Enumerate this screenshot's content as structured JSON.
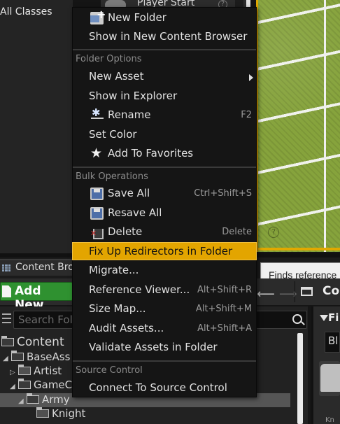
{
  "background": {
    "class_picker_label": "All Classes",
    "outliner_item": "Player Start",
    "outliner_help": "?",
    "viewport_help": "?"
  },
  "content_browser": {
    "tab_label": "Content Bro",
    "add_new_label": "Add New",
    "breadcrumb_text": "Co",
    "search_placeholder": "Search Fold",
    "filters_label": "Fi",
    "filter_chip": "Bl",
    "asset_name": "Kn",
    "tree": [
      {
        "label": "Content",
        "expander": "",
        "open": true
      },
      {
        "label": "BaseAss",
        "expander": "◢",
        "open": true
      },
      {
        "label": "Artist",
        "expander": "▷",
        "open": false
      },
      {
        "label": "GameC",
        "expander": "◢",
        "open": true
      },
      {
        "label": "Army",
        "expander": "◢",
        "open": true
      },
      {
        "label": "Knight",
        "expander": "",
        "open": false
      }
    ]
  },
  "tooltip": "Finds reference",
  "menu": {
    "new_folder": "New Folder",
    "show_in_new_cb": "Show in New Content Browser",
    "section_folder_options": "Folder Options",
    "new_asset": "New Asset",
    "show_in_explorer": "Show in Explorer",
    "rename": "Rename",
    "rename_shortcut": "F2",
    "set_color": "Set Color",
    "add_to_favorites": "Add To Favorites",
    "section_bulk": "Bulk Operations",
    "save_all": "Save All",
    "save_all_shortcut": "Ctrl+Shift+S",
    "resave_all": "Resave All",
    "delete": "Delete",
    "delete_shortcut": "Delete",
    "fix_up_redirectors": "Fix Up Redirectors in Folder",
    "migrate": "Migrate...",
    "reference_viewer": "Reference Viewer...",
    "reference_viewer_shortcut": "Alt+Shift+R",
    "size_map": "Size Map...",
    "size_map_shortcut": "Alt+Shift+M",
    "audit_assets": "Audit Assets...",
    "audit_assets_shortcut": "Alt+Shift+A",
    "validate_assets": "Validate Assets in Folder",
    "section_source_control": "Source Control",
    "connect_source_control": "Connect To Source Control"
  },
  "colors": {
    "highlight": "#e3a500",
    "add_new_green": "#2f9130",
    "grass": "#86a33c",
    "menu_bg": "#151515"
  }
}
